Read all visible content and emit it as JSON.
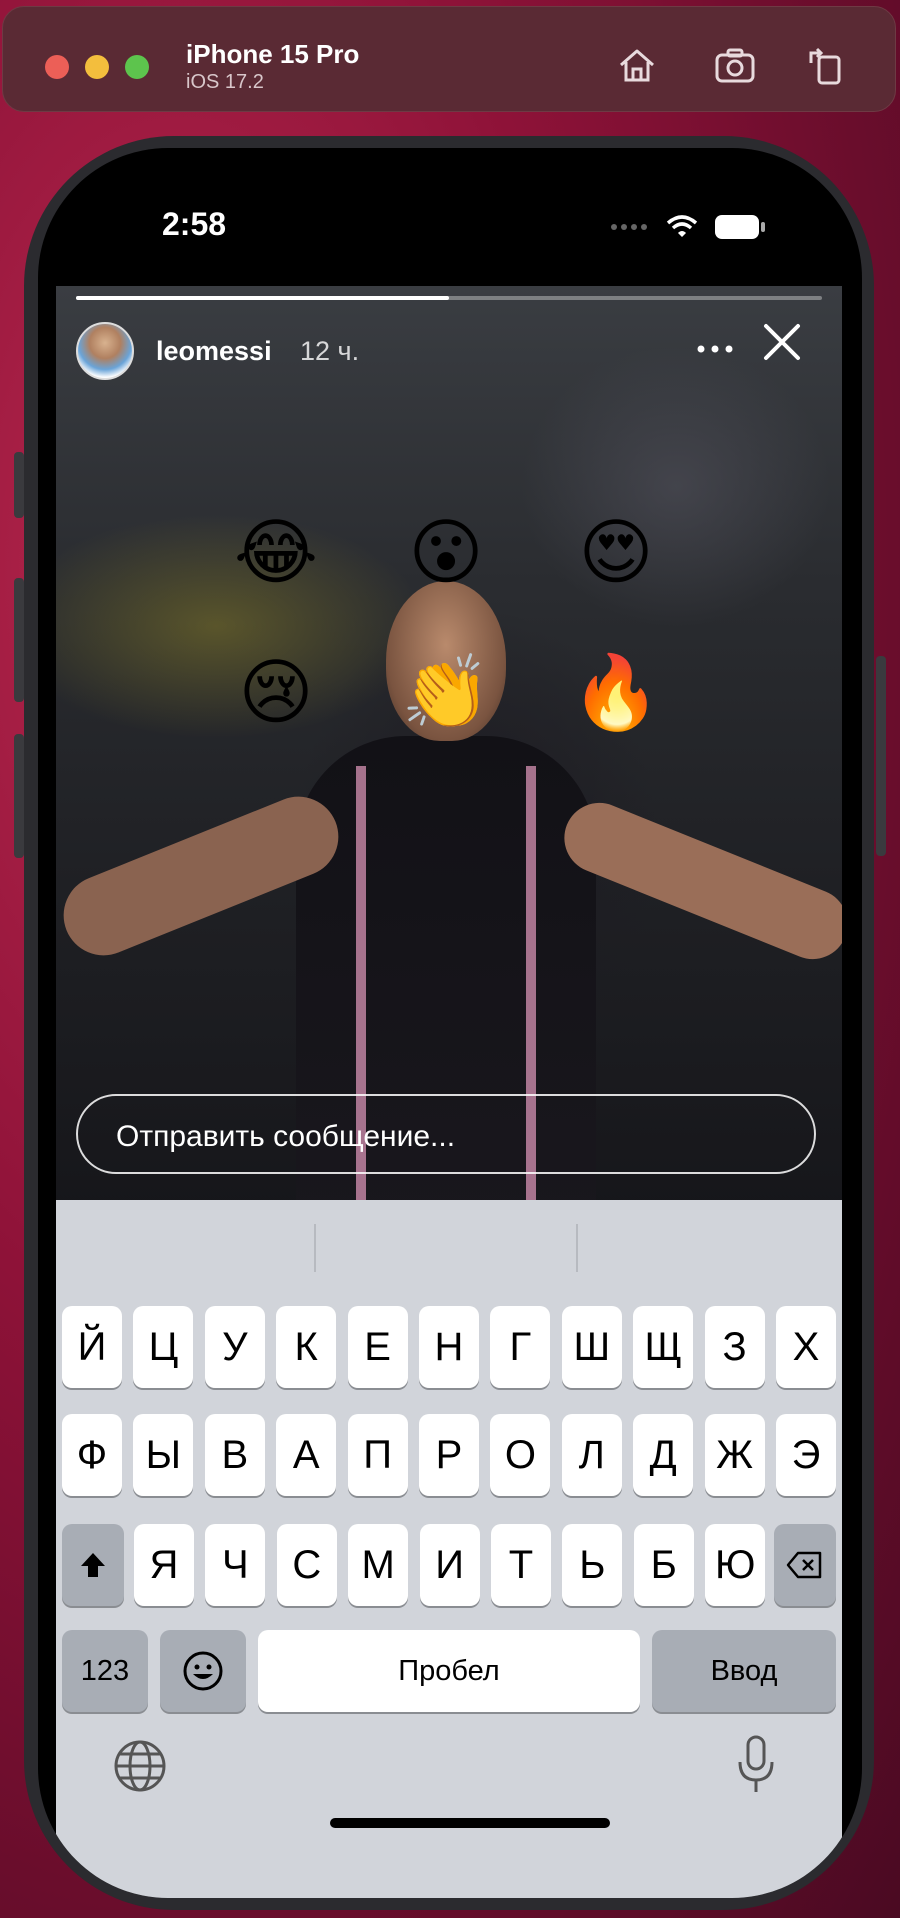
{
  "window": {
    "device_name": "iPhone 15 Pro",
    "os_version": "iOS 17.2",
    "toolbar_icons": [
      "home-icon",
      "screenshot-icon",
      "rotate-icon"
    ]
  },
  "status_bar": {
    "time": "2:58",
    "icons": [
      "cellular-icon",
      "wifi-icon",
      "battery-icon"
    ]
  },
  "story": {
    "progress": 0.5,
    "username": "leomessi",
    "time_ago": "12 ч.",
    "icons": [
      "more-icon",
      "close-icon"
    ]
  },
  "reactions": [
    "😂",
    "😮",
    "😍",
    "😢",
    "👏",
    "🔥"
  ],
  "message": {
    "placeholder": "Отправить сообщение..."
  },
  "keyboard": {
    "row1": [
      "Й",
      "Ц",
      "У",
      "К",
      "Е",
      "Н",
      "Г",
      "Ш",
      "Щ",
      "З",
      "Х"
    ],
    "row2": [
      "Ф",
      "Ы",
      "В",
      "А",
      "П",
      "Р",
      "О",
      "Л",
      "Д",
      "Ж",
      "Э"
    ],
    "row3": [
      "Я",
      "Ч",
      "С",
      "М",
      "И",
      "Т",
      "Ь",
      "Б",
      "Ю"
    ],
    "numbers_label": "123",
    "space_label": "Пробел",
    "return_label": "Ввод",
    "icons": [
      "shift-icon",
      "backspace-icon",
      "emoji-icon",
      "globe-icon",
      "microphone-icon"
    ]
  }
}
